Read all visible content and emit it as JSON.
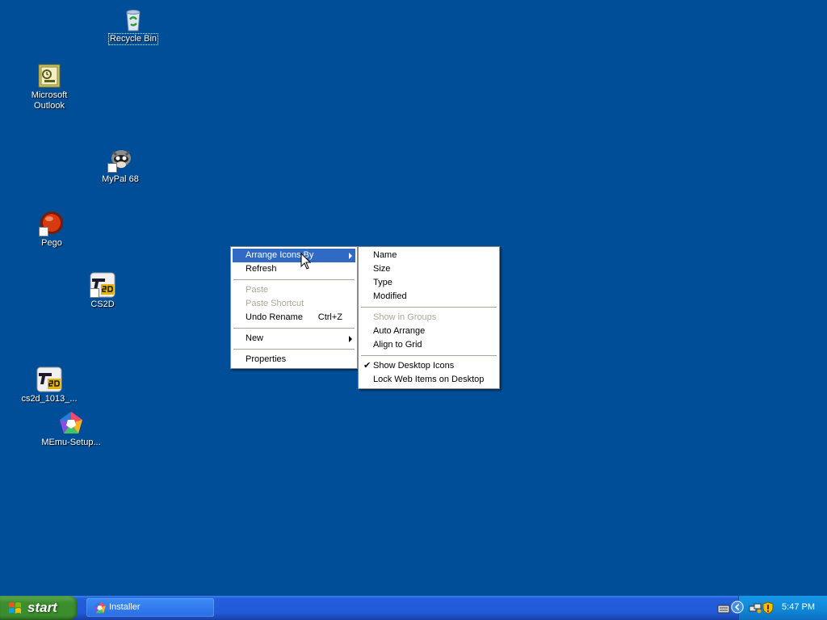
{
  "desktop": {
    "background_color": "#004e98",
    "icons": [
      {
        "label": "Recycle Bin",
        "icon": "recycle-bin-icon",
        "selected": true
      },
      {
        "label": "Microsoft Outlook",
        "icon": "outlook-icon"
      },
      {
        "label": "MyPal 68",
        "icon": "mypal-icon"
      },
      {
        "label": "Pego",
        "icon": "pego-icon"
      },
      {
        "label": "CS2D",
        "icon": "cs2d-icon"
      },
      {
        "label": "cs2d_1013_...",
        "icon": "cs2d-icon"
      },
      {
        "label": "MEmu-Setup...",
        "icon": "memu-icon"
      }
    ]
  },
  "context_menu": {
    "items": [
      {
        "label": "Arrange Icons By",
        "highlighted": true,
        "submenu": true
      },
      {
        "label": "Refresh"
      },
      {
        "label": "Paste",
        "disabled": true
      },
      {
        "label": "Paste Shortcut",
        "disabled": true
      },
      {
        "label": "Undo Rename",
        "shortcut": "Ctrl+Z"
      },
      {
        "label": "New",
        "submenu": true
      },
      {
        "label": "Properties"
      }
    ]
  },
  "submenu": {
    "items": [
      {
        "label": "Name"
      },
      {
        "label": "Size"
      },
      {
        "label": "Type"
      },
      {
        "label": "Modified"
      },
      {
        "label": "Show in Groups",
        "disabled": true
      },
      {
        "label": "Auto Arrange"
      },
      {
        "label": "Align to Grid"
      },
      {
        "label": "Show Desktop Icons",
        "checked": true,
        "check_glyph": "✔"
      },
      {
        "label": "Lock Web Items on Desktop"
      }
    ]
  },
  "taskbar": {
    "start_label": "start",
    "tasks": [
      {
        "label": "Installer",
        "icon": "installer-icon"
      }
    ],
    "tray": {
      "time": "5:47 PM",
      "icons": [
        "keyboard-icon",
        "expand-tray-icon",
        "network-icon",
        "security-shield-icon"
      ]
    }
  },
  "colors": {
    "menu_highlight": "#316ac5",
    "disabled_text": "#aca899",
    "taskbar_blue": "#245edb",
    "start_green": "#3c8d2e"
  }
}
